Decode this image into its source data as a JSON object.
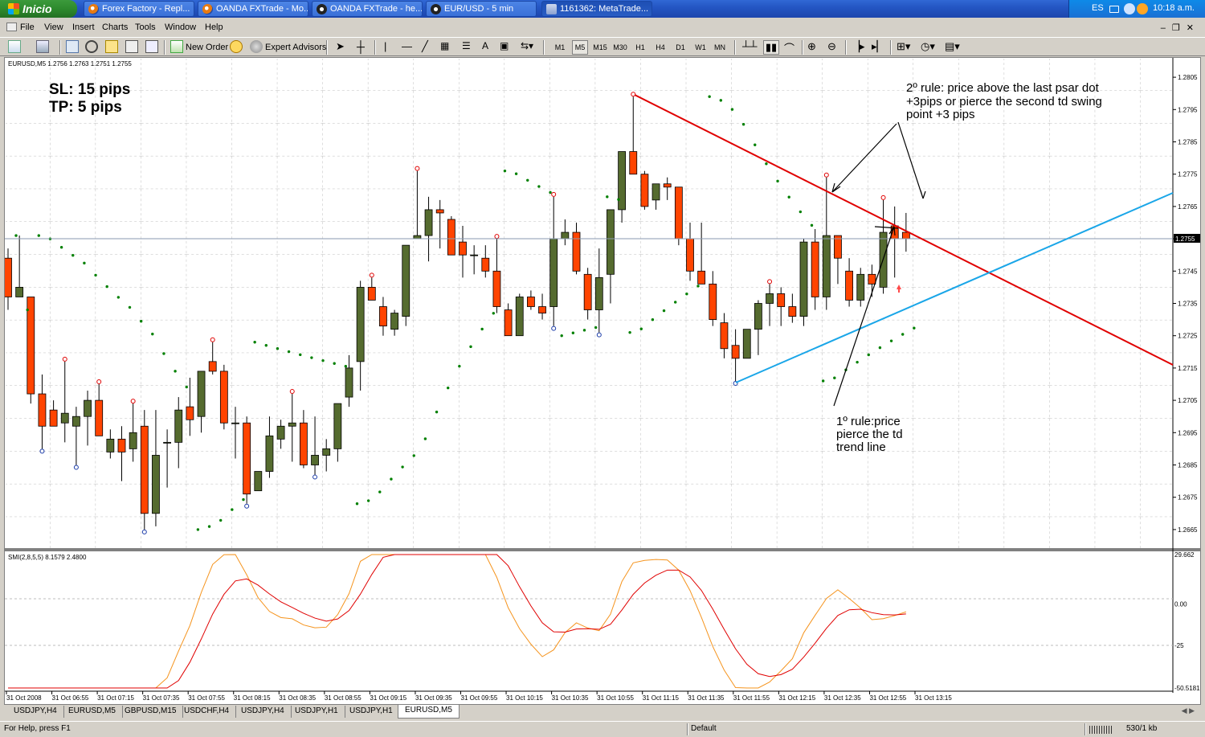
{
  "taskbar": {
    "start_label": "Inicio",
    "windows": [
      {
        "label": "Forex Factory - Repl..."
      },
      {
        "label": "OANDA FXTrade - Mo..."
      },
      {
        "label": "OANDA FXTrade - he..."
      },
      {
        "label": "EUR/USD - 5 min"
      },
      {
        "label": "1161362: MetaTrade..."
      }
    ],
    "lang": "ES",
    "clock": "10:18 a.m."
  },
  "menu": [
    "File",
    "View",
    "Insert",
    "Charts",
    "Tools",
    "Window",
    "Help"
  ],
  "toolbar": {
    "new_order": "New Order",
    "expert_advisors": "Expert Advisors",
    "timeframes": [
      "M1",
      "M5",
      "M15",
      "M30",
      "H1",
      "H4",
      "D1",
      "W1",
      "MN"
    ],
    "selected_timeframe": "M5"
  },
  "chart": {
    "header": "EURUSD,M5  1.2756 1.2763 1.2751 1.2755",
    "sl": "SL: 15 pips",
    "tp": "TP: 5 pips",
    "annotation_rule2": [
      "2º rule: price above the last psar dot",
      "+3pips or pierce the second td swing",
      "point +3 pips"
    ],
    "annotation_rule1": [
      "1º rule:price",
      "pierce the td",
      "trend line"
    ],
    "current_price": "1.2755",
    "price_labels": [
      "1.2805",
      "1.2795",
      "1.2785",
      "1.2775",
      "1.2765",
      "1.2755",
      "1.2745",
      "1.2735",
      "1.2725",
      "1.2715",
      "1.2705",
      "1.2695",
      "1.2685",
      "1.2675",
      "1.2665"
    ],
    "smi_header": "SMI(2,8,5,5) 8.1579 2.4800",
    "smi_labels": [
      "29.662",
      "0.00",
      "-25",
      "-50.5181"
    ],
    "time_labels": [
      "31 Oct 2008",
      "31 Oct 06:55",
      "31 Oct 07:15",
      "31 Oct 07:35",
      "31 Oct 07:55",
      "31 Oct 08:15",
      "31 Oct 08:35",
      "31 Oct 08:55",
      "31 Oct 09:15",
      "31 Oct 09:35",
      "31 Oct 09:55",
      "31 Oct 10:15",
      "31 Oct 10:35",
      "31 Oct 10:55",
      "31 Oct 11:15",
      "31 Oct 11:35",
      "31 Oct 11:55",
      "31 Oct 12:15",
      "31 Oct 12:35",
      "31 Oct 12:55",
      "31 Oct 13:15"
    ]
  },
  "chart_data": {
    "type": "candlestick",
    "symbol": "EURUSD",
    "timeframe": "M5",
    "ylim": [
      1.266,
      1.281
    ],
    "candles": [
      [
        1.2749,
        1.2752,
        1.2733,
        1.2737
      ],
      [
        1.2737,
        1.2756,
        1.274,
        1.274
      ],
      [
        1.2737,
        1.2737,
        1.2704,
        1.2707
      ],
      [
        1.2707,
        1.2713,
        1.269,
        1.2697
      ],
      [
        1.2702,
        1.2705,
        1.2697,
        1.2697
      ],
      [
        1.2698,
        1.2717,
        1.2692,
        1.2701
      ],
      [
        1.2697,
        1.2703,
        1.2685,
        1.27
      ],
      [
        1.27,
        1.2708,
        1.2691,
        1.2705
      ],
      [
        1.2705,
        1.271,
        1.2694,
        1.2694
      ],
      [
        1.2689,
        1.2696,
        1.2687,
        1.2693
      ],
      [
        1.2693,
        1.2697,
        1.268,
        1.2689
      ],
      [
        1.269,
        1.2704,
        1.2686,
        1.2695
      ],
      [
        1.2697,
        1.2702,
        1.2665,
        1.267
      ],
      [
        1.267,
        1.2702,
        1.2666,
        1.2688
      ],
      [
        1.2692,
        1.2696,
        1.2678,
        1.2692
      ],
      [
        1.2692,
        1.2706,
        1.2684,
        1.2702
      ],
      [
        1.2703,
        1.2712,
        1.2694,
        1.2699
      ],
      [
        1.27,
        1.2714,
        1.2695,
        1.2714
      ],
      [
        1.2717,
        1.2723,
        1.2713,
        1.2714
      ],
      [
        1.2714,
        1.2716,
        1.2696,
        1.2698
      ],
      [
        1.2698,
        1.2703,
        1.2687,
        1.2698
      ],
      [
        1.2698,
        1.27,
        1.2673,
        1.2676
      ],
      [
        1.2677,
        1.2683,
        1.2677,
        1.2683
      ],
      [
        1.2683,
        1.27,
        1.2681,
        1.2694
      ],
      [
        1.2693,
        1.2699,
        1.269,
        1.2697
      ],
      [
        1.2697,
        1.2707,
        1.2686,
        1.2698
      ],
      [
        1.2698,
        1.2702,
        1.2684,
        1.2685
      ],
      [
        1.2685,
        1.27,
        1.2682,
        1.2688
      ],
      [
        1.2688,
        1.2693,
        1.2683,
        1.269
      ],
      [
        1.269,
        1.2704,
        1.2686,
        1.2704
      ],
      [
        1.2706,
        1.2719,
        1.2703,
        1.2715
      ],
      [
        1.2717,
        1.2742,
        1.2708,
        1.274
      ],
      [
        1.274,
        1.2743,
        1.2736,
        1.2736
      ],
      [
        1.2734,
        1.2737,
        1.2725,
        1.2728
      ],
      [
        1.2727,
        1.2733,
        1.2725,
        1.2732
      ],
      [
        1.2731,
        1.2753,
        1.2728,
        1.2753
      ],
      [
        1.2755,
        1.2776,
        1.2755,
        1.2756
      ],
      [
        1.2756,
        1.2768,
        1.2748,
        1.2764
      ],
      [
        1.2764,
        1.2767,
        1.2752,
        1.2763
      ],
      [
        1.2761,
        1.2762,
        1.275,
        1.275
      ],
      [
        1.2754,
        1.2759,
        1.2743,
        1.275
      ],
      [
        1.275,
        1.2753,
        1.2744,
        1.275
      ],
      [
        1.2749,
        1.2753,
        1.2743,
        1.2745
      ],
      [
        1.2745,
        1.2755,
        1.2732,
        1.2734
      ],
      [
        1.2733,
        1.2735,
        1.2725,
        1.2725
      ],
      [
        1.2725,
        1.2738,
        1.2725,
        1.2737
      ],
      [
        1.2737,
        1.2739,
        1.2733,
        1.2734
      ],
      [
        1.2734,
        1.2738,
        1.273,
        1.2732
      ],
      [
        1.2734,
        1.2768,
        1.2728,
        1.2755
      ],
      [
        1.2755,
        1.2761,
        1.2753,
        1.2757
      ],
      [
        1.2757,
        1.276,
        1.2744,
        1.2745
      ],
      [
        1.2744,
        1.2746,
        1.273,
        1.2733
      ],
      [
        1.2733,
        1.2752,
        1.2726,
        1.2743
      ],
      [
        1.2744,
        1.2762,
        1.2735,
        1.2764
      ],
      [
        1.2764,
        1.2781,
        1.276,
        1.2782
      ],
      [
        1.2782,
        1.2799,
        1.2775,
        1.2775
      ],
      [
        1.2775,
        1.2776,
        1.2764,
        1.2765
      ],
      [
        1.2767,
        1.2772,
        1.2764,
        1.2772
      ],
      [
        1.2772,
        1.2774,
        1.2767,
        1.2771
      ],
      [
        1.2771,
        1.2771,
        1.2753,
        1.2755
      ],
      [
        1.2755,
        1.276,
        1.2742,
        1.2745
      ],
      [
        1.2745,
        1.276,
        1.2741,
        1.2741
      ],
      [
        1.2741,
        1.2745,
        1.2728,
        1.273
      ],
      [
        1.2729,
        1.2732,
        1.2718,
        1.2721
      ],
      [
        1.2722,
        1.2727,
        1.2711,
        1.2718
      ],
      [
        1.2718,
        1.2727,
        1.2718,
        1.2727
      ],
      [
        1.2727,
        1.2736,
        1.2719,
        1.2735
      ],
      [
        1.2735,
        1.2741,
        1.2728,
        1.2738
      ],
      [
        1.2738,
        1.274,
        1.2728,
        1.2734
      ],
      [
        1.2734,
        1.2738,
        1.2729,
        1.2731
      ],
      [
        1.2731,
        1.2755,
        1.2728,
        1.2754
      ],
      [
        1.2754,
        1.2758,
        1.2733,
        1.2737
      ],
      [
        1.2737,
        1.2774,
        1.2733,
        1.2756
      ],
      [
        1.2756,
        1.2756,
        1.2741,
        1.2749
      ],
      [
        1.2745,
        1.2749,
        1.2734,
        1.2736
      ],
      [
        1.2736,
        1.2746,
        1.2734,
        1.2744
      ],
      [
        1.2744,
        1.2747,
        1.2737,
        1.2741
      ],
      [
        1.274,
        1.2767,
        1.2738,
        1.2757
      ],
      [
        1.2759,
        1.2765,
        1.2743,
        1.2755
      ],
      [
        1.2757,
        1.2763,
        1.2751,
        1.2755
      ]
    ],
    "psar_dots": true,
    "trendlines": [
      {
        "name": "td resistance",
        "color": "#e00000"
      },
      {
        "name": "td support",
        "color": "#1aa6e8"
      }
    ],
    "smi": {
      "name": "SMI(2,8,5,5)",
      "ylim": [
        -50.5181,
        29.662
      ]
    }
  },
  "tabs": [
    "USDJPY,H4",
    "EURUSD,M5",
    "GBPUSD,M15",
    "USDCHF,H4",
    "USDJPY,H4",
    "USDJPY,H1",
    "USDJPY,H1",
    "EURUSD,M5"
  ],
  "active_tab_index": 7,
  "status": {
    "help": "For Help, press F1",
    "profile": "Default",
    "traffic": "530/1 kb"
  },
  "colors": {
    "bull": "#556b2f",
    "bear": "#ff4400",
    "psar": "#008000",
    "grid": "#c0c0c0"
  }
}
